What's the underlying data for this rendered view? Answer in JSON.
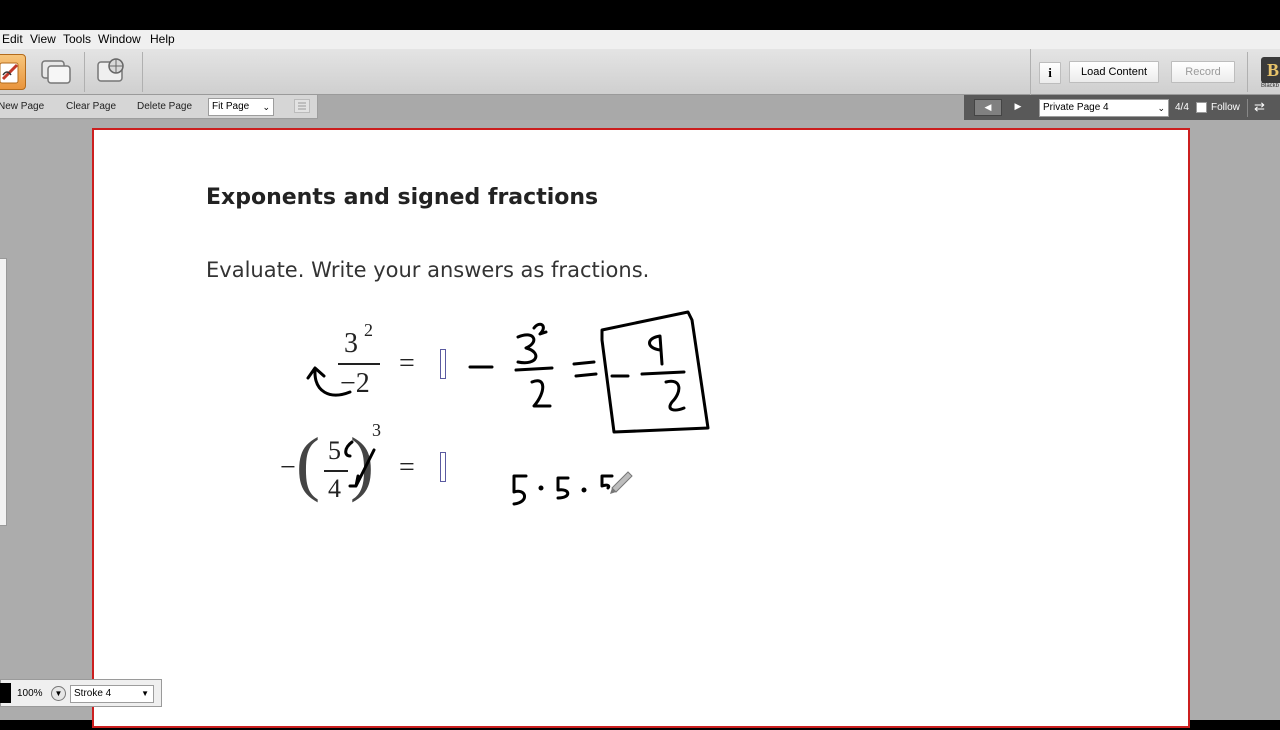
{
  "menu": [
    "Edit",
    "View",
    "Tools",
    "Window",
    "Help"
  ],
  "toolbar": {
    "info_label": "i",
    "load_content": "Load Content",
    "record": "Record",
    "brand_letter": "B",
    "brand_small": "Blackb"
  },
  "pagebar": {
    "new_page": "New Page",
    "clear_page": "Clear Page",
    "delete_page": "Delete Page",
    "zoom_select": "Fit Page"
  },
  "nav": {
    "page_select": "Private Page 4",
    "page_count": "4/4",
    "follow": "Follow"
  },
  "content": {
    "heading": "Exponents and signed fractions",
    "instruction": "Evaluate. Write your answers as fractions.",
    "p1": {
      "num": "3",
      "exp": "2",
      "den": "−2",
      "eq": "="
    },
    "p2": {
      "minus": "−",
      "num": "5",
      "den": "4",
      "exp": "3",
      "eq": "="
    }
  },
  "bottom": {
    "zoom": "100%",
    "stroke": "Stroke 4"
  },
  "colors": {
    "page_border": "#cc1f1f",
    "active_tool": "#e9953d"
  }
}
